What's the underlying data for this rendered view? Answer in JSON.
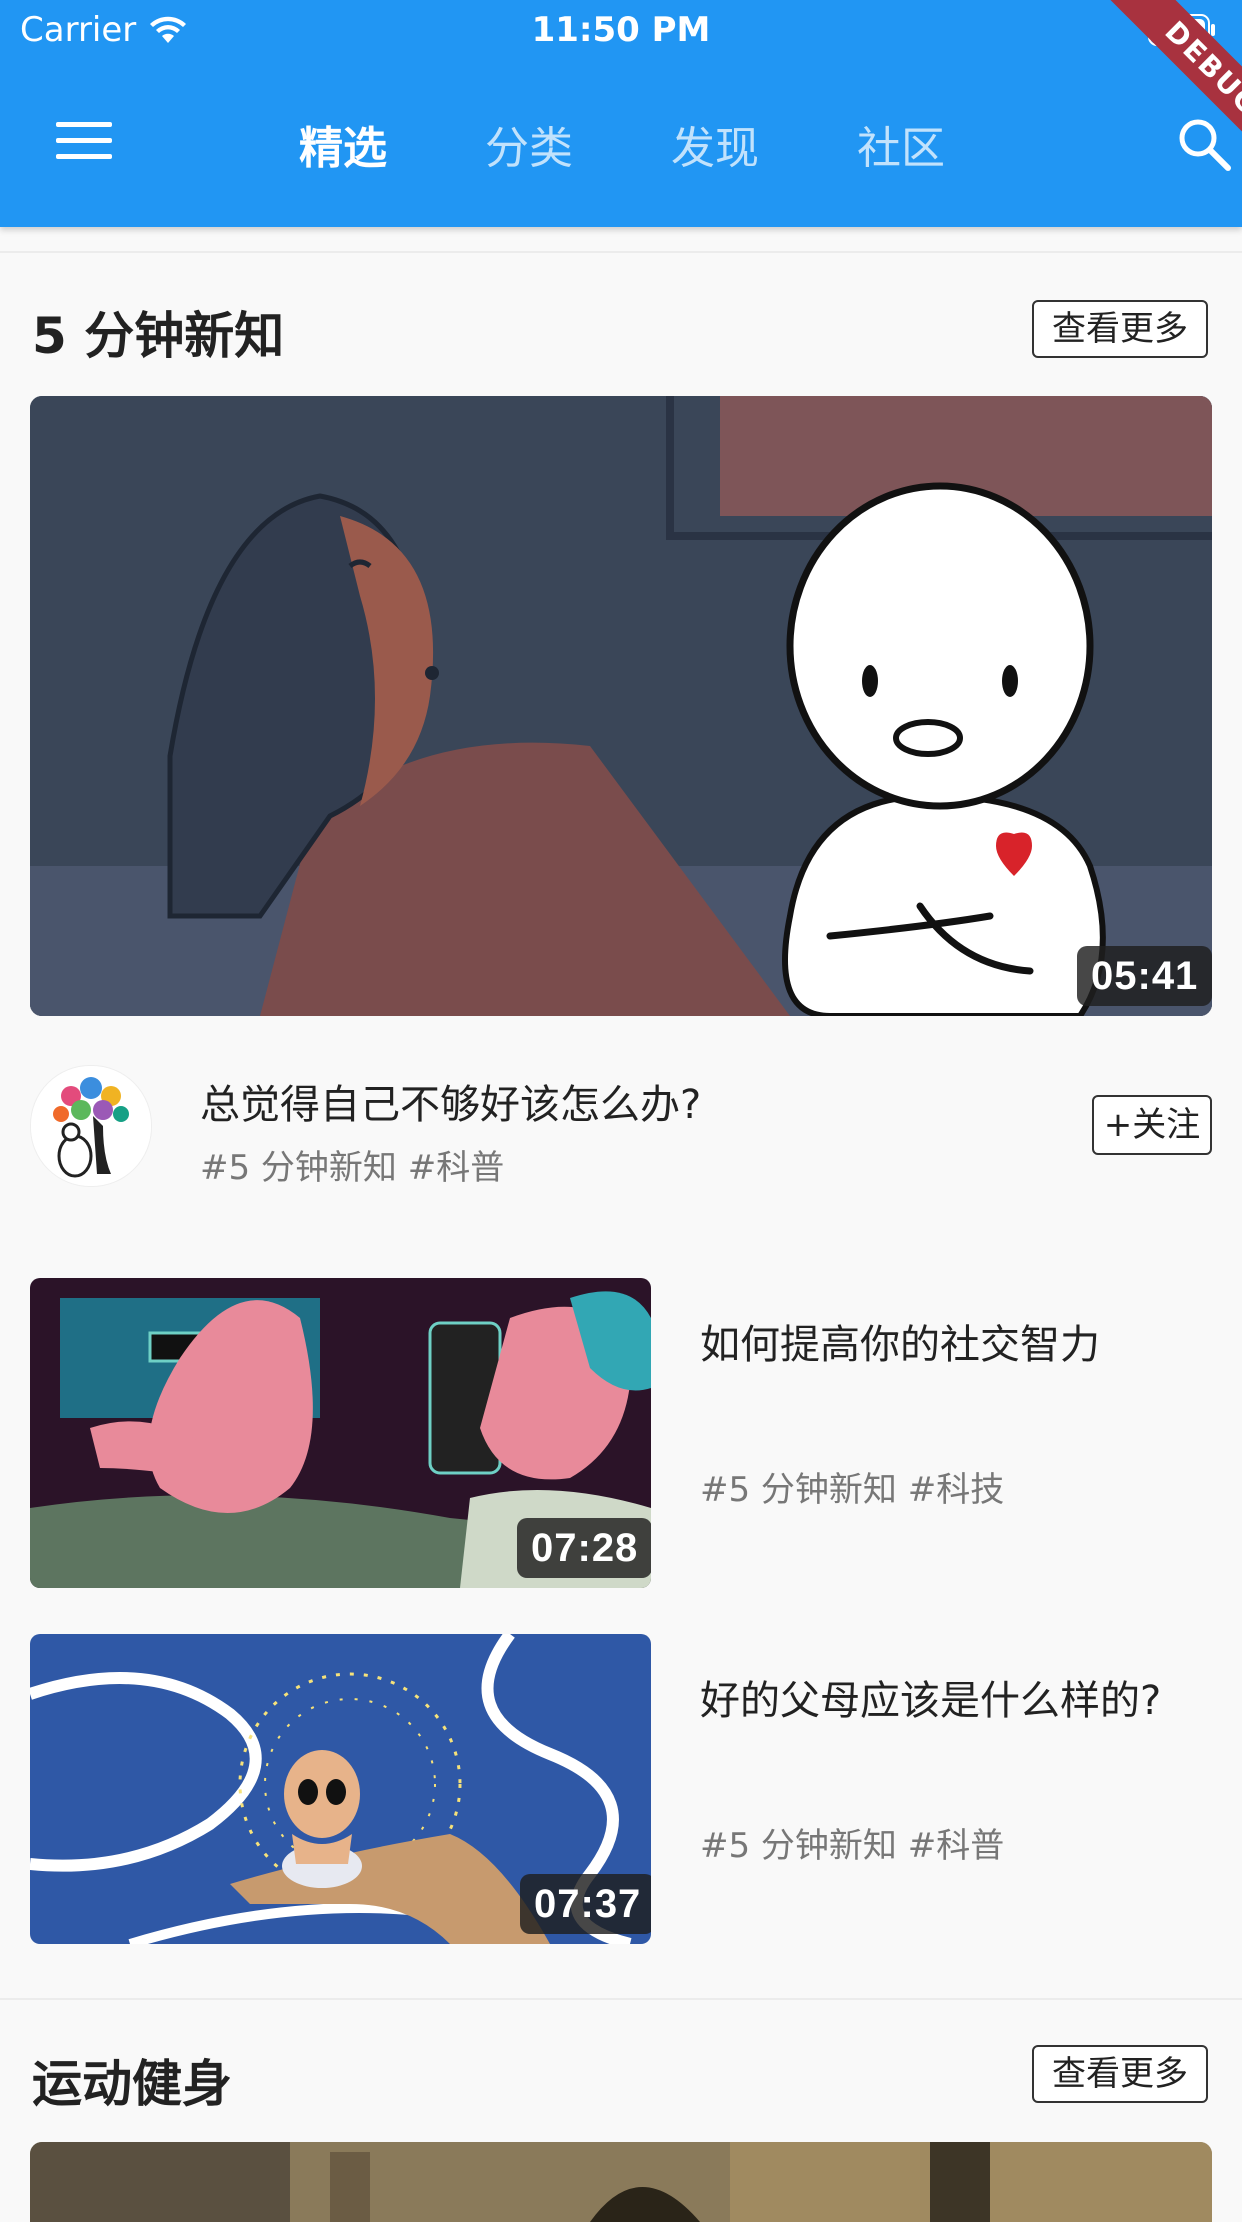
{
  "status_bar": {
    "carrier": "Carrier",
    "time": "11:50 PM"
  },
  "app_bar": {
    "tabs": [
      {
        "label": "精选",
        "active": true
      },
      {
        "label": "分类",
        "active": false
      },
      {
        "label": "发现",
        "active": false
      },
      {
        "label": "社区",
        "active": false
      }
    ],
    "debug_banner": "DEBUG",
    "color": "#2196f3"
  },
  "sections": [
    {
      "title": "5 分钟新知",
      "more_label": "查看更多",
      "featured": {
        "duration": "05:41",
        "title": "总觉得自己不够好该怎么办?",
        "tags": "#5 分钟新知 #科普",
        "follow_label": "+关注"
      },
      "items": [
        {
          "title": "如何提高你的社交智力",
          "tags": "#5 分钟新知 #科技",
          "duration": "07:28"
        },
        {
          "title": "好的父母应该是什么样的?",
          "tags": "#5 分钟新知 #科普",
          "duration": "07:37"
        }
      ]
    },
    {
      "title": "运动健身",
      "more_label": "查看更多"
    }
  ]
}
